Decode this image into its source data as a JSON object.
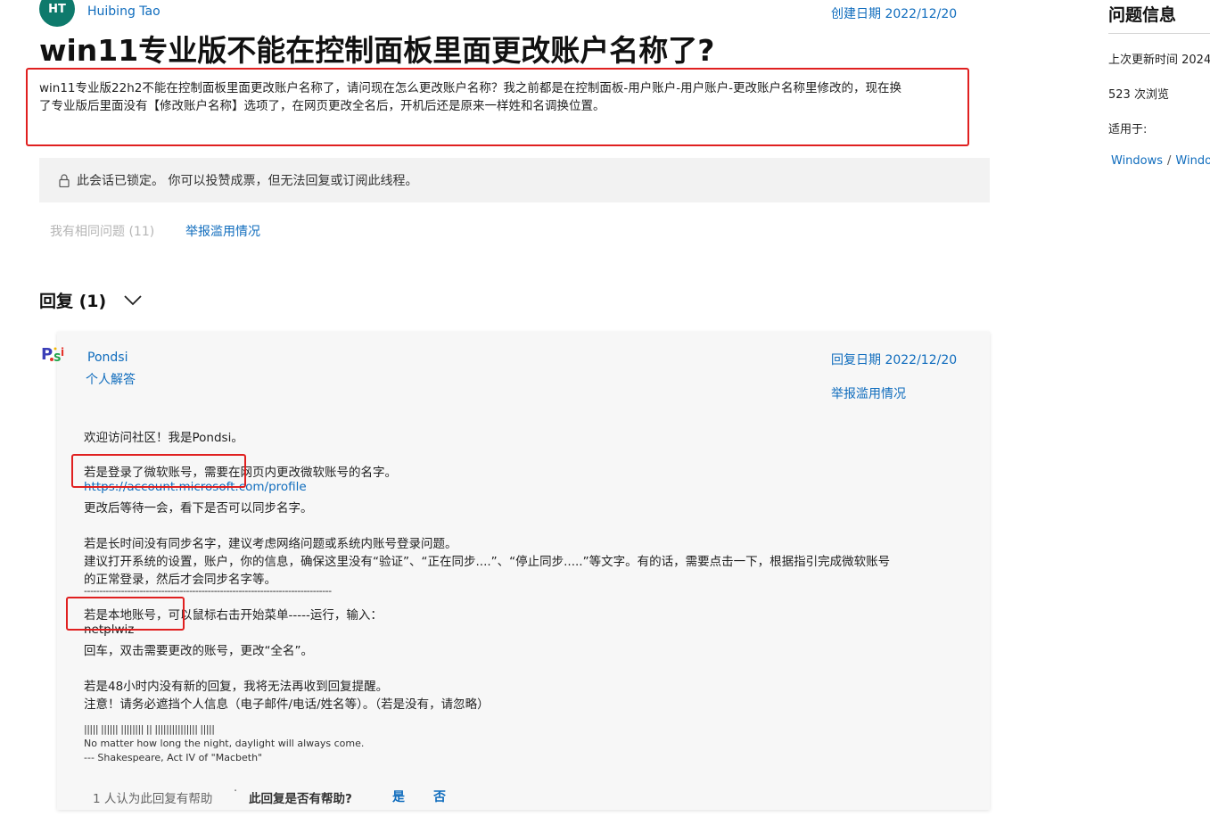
{
  "question": {
    "author_initials": "HT",
    "author_name": "Huibing Tao",
    "created_date": "创建日期 2022/12/20",
    "title": "win11专业版不能在控制面板里面更改账户名称了?",
    "body_line1": "win11专业版22h2不能在控制面板里面更改账户名称了，请问现在怎么更改账户名称？我之前都是在控制面板-用户账户-用户账户-更改账户名称里修改的，现在换",
    "body_line2": "了专业版后里面没有【修改账户名称】选项了，在网页更改全名后，开机后还是原来一样姓和名调换位置。",
    "locked_notice": "此会话已锁定。 你可以投赞成票，但无法回复或订阅此线程。",
    "same_question": "我有相同问题 (11)",
    "report_abuse": "举报滥用情况"
  },
  "replies": {
    "heading": "回复 (1)",
    "reply": {
      "author": "Pondsi",
      "role": "个人解答",
      "date": "回复日期 2022/12/20",
      "report_abuse": "举报滥用情况",
      "lines": {
        "l1": "欢迎访问社区！我是Pondsi。",
        "l2": "若是登录了微软账号，需要在网页内更改微软账号的名字。",
        "link": "https://account.microsoft.com/profile",
        "l3": "更改后等待一会，看下是否可以同步名字。",
        "l4": "若是长时间没有同步名字，建议考虑网络问题或系统内账号登录问题。",
        "l5": "建议打开系统的设置，账户，你的信息，确保这里没有“验证”、“正在同步....”、“停止同步.....”等文字。有的话，需要点击一下，根据指引完成微软账号",
        "l6": "的正常登录，然后才会同步名字等。",
        "divider": "--------------------------------------------------------------------------------",
        "l7": "若是本地账号，可以鼠标右击开始菜单-----运行，输入：",
        "l8": "netplwiz",
        "l9": "回车，双击需要更改的账号，更改“全名”。",
        "l10": "若是48小时内没有新的回复，我将无法再收到回复提醒。",
        "l11": "注意！请务必遮挡个人信息（电子邮件/电话/姓名等）。（若是没有，请忽略）",
        "sig_bars": "||||| |||||| |||||||| || ||||||||||||||| |||||",
        "sig1": "No matter how long the night, daylight will always come.",
        "sig2": "--- Shakespeare, Act IV of \"Macbeth\""
      },
      "helpful_count": "1 人认为此回复有帮助",
      "helpful_question": "此回复是否有帮助?",
      "yes": "是",
      "no": "否"
    }
  },
  "sidebar": {
    "title": "问题信息",
    "updated": "上次更新时间 2024",
    "views": "523 次浏览",
    "applies_to": "适用于:",
    "tag1": "Windows",
    "tag_sep": "/",
    "tag2": "Windo"
  }
}
